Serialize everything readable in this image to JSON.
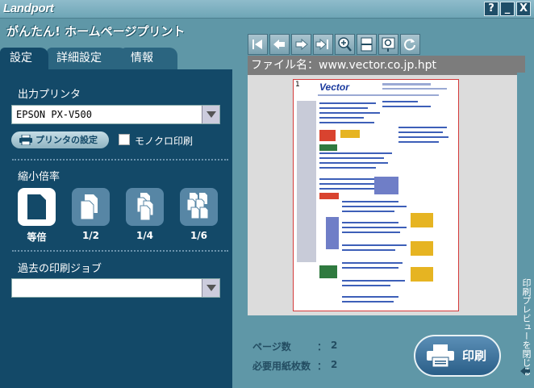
{
  "app": {
    "logo": "Landport",
    "brand": "がんたん! ホームページプリント"
  },
  "window": {
    "help": "?",
    "minimize": "_",
    "close": "X"
  },
  "tabs": [
    {
      "label": "設定"
    },
    {
      "label": "詳細設定"
    },
    {
      "label": "情報"
    }
  ],
  "printer": {
    "section_label": "出力プリンタ",
    "selected": "EPSON PX-V500",
    "settings_button": "プリンタの設定",
    "mono_label": "モノクロ印刷",
    "mono_checked": false
  },
  "scale": {
    "section_label": "縮小倍率",
    "options": [
      {
        "label": "等倍",
        "selected": true
      },
      {
        "label": "1/2"
      },
      {
        "label": "1/4"
      },
      {
        "label": "1/6"
      }
    ]
  },
  "history": {
    "section_label": "過去の印刷ジョブ",
    "selected": ""
  },
  "toolbar": {
    "icons": [
      "first-page-icon",
      "prev-page-icon",
      "next-page-icon",
      "last-page-icon",
      "zoom-in-icon",
      "fit-page-icon",
      "zoom-tool-icon",
      "refresh-icon"
    ]
  },
  "preview": {
    "filename": "ファイル名：www.vector.co.jp.hpt",
    "page_number": "1",
    "site_logo": "Vector"
  },
  "stats": {
    "pages_label": "ページ数",
    "pages_value": "2",
    "sheets_label": "必要用紙枚数",
    "sheets_value": "2",
    "colon": "："
  },
  "print_button": "印刷",
  "close_preview": "印刷プレビューを閉じる"
}
